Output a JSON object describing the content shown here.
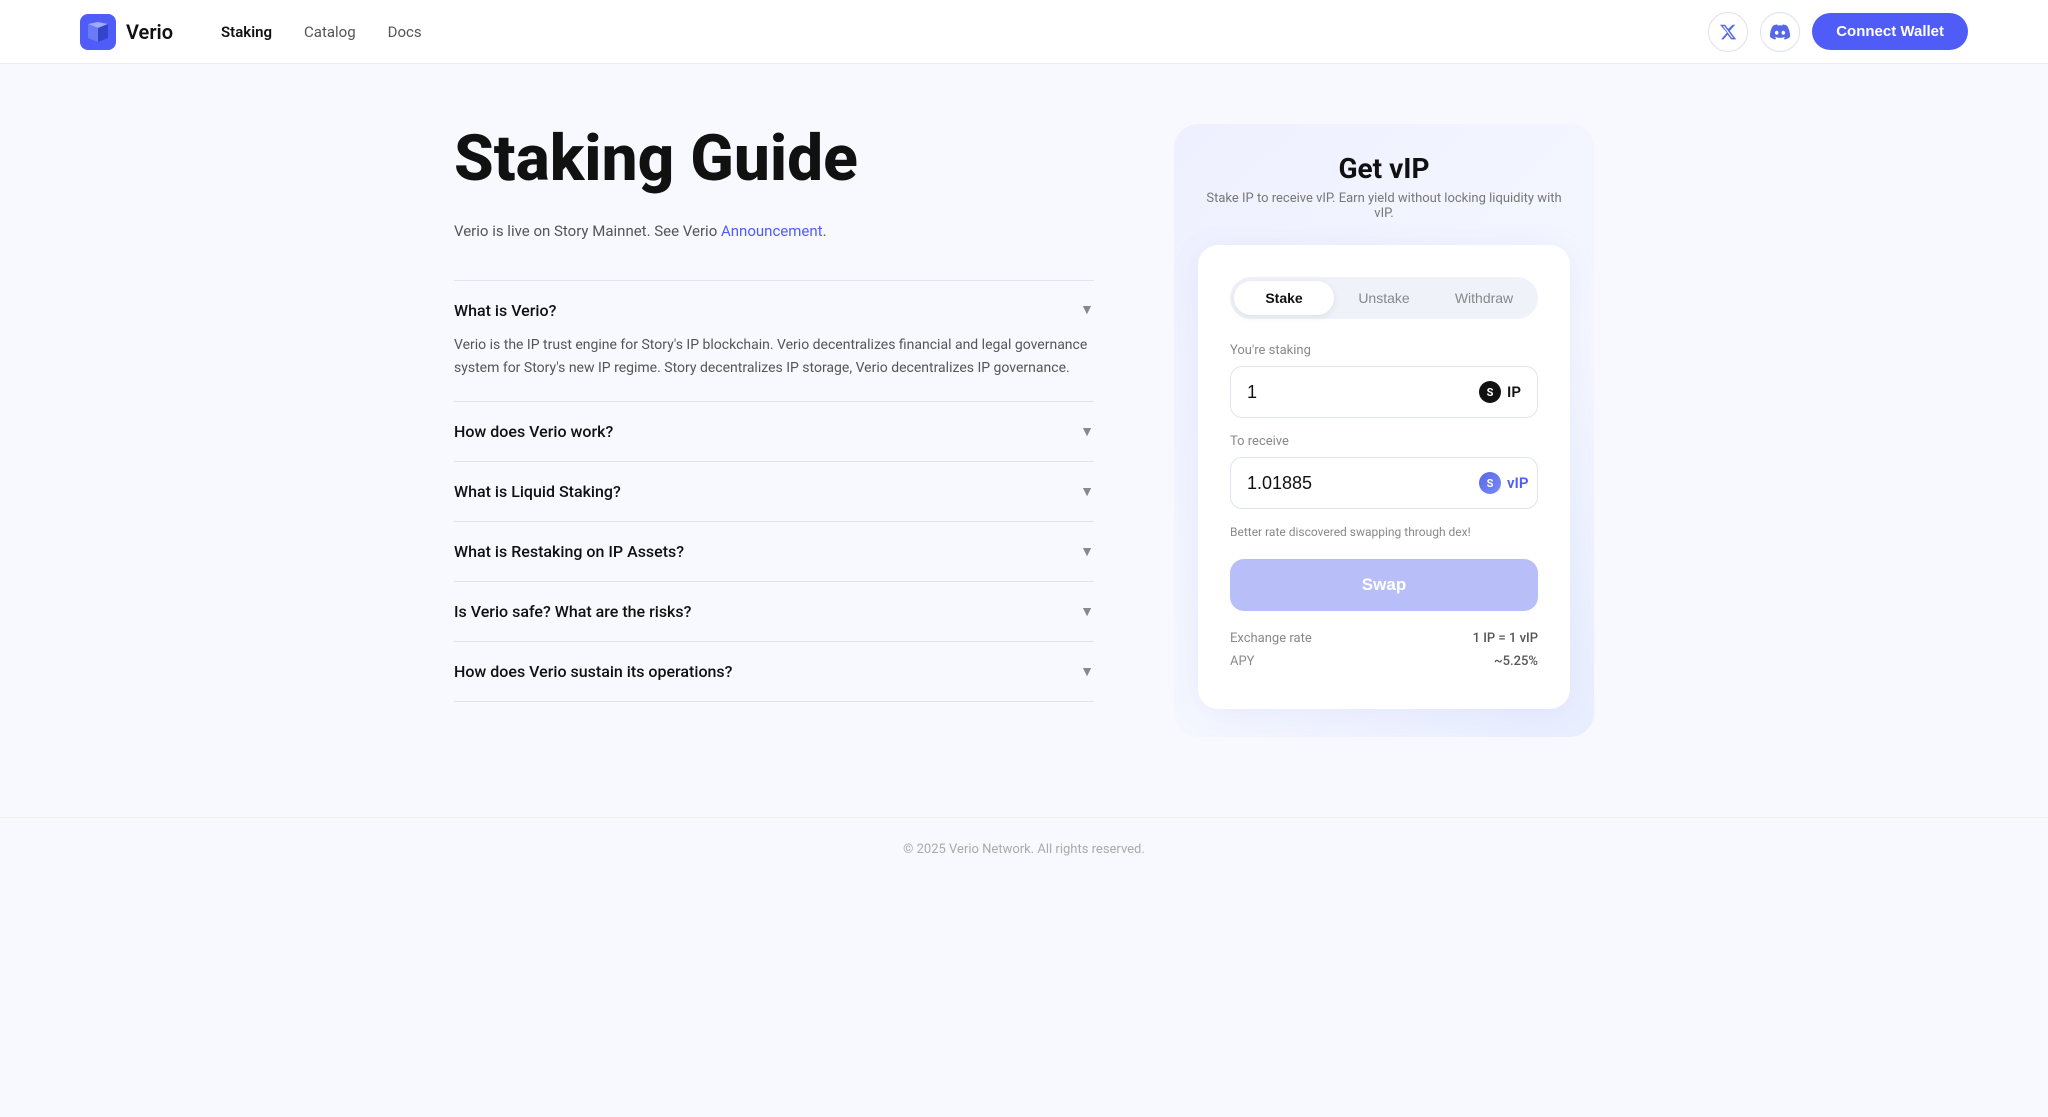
{
  "brand": {
    "name": "Verio",
    "logo_alt": "Verio logo"
  },
  "navbar": {
    "links": [
      {
        "label": "Staking",
        "active": true
      },
      {
        "label": "Catalog",
        "active": false
      },
      {
        "label": "Docs",
        "active": false
      }
    ],
    "twitter_label": "X",
    "discord_label": "Discord",
    "connect_wallet": "Connect Wallet"
  },
  "left": {
    "title": "Staking Guide",
    "subtitle_prefix": "Verio is live on Story Mainnet. See Verio ",
    "subtitle_link": "Announcement",
    "subtitle_suffix": ".",
    "faq": [
      {
        "id": "what-is-verio",
        "question": "What is Verio?",
        "open": true,
        "answer": "Verio is the IP trust engine for Story's IP blockchain. Verio decentralizes financial and legal governance system for Story's new IP regime. Story decentralizes IP storage, Verio decentralizes IP governance."
      },
      {
        "id": "how-does-verio-work",
        "question": "How does Verio work?",
        "open": false,
        "answer": ""
      },
      {
        "id": "what-is-liquid-staking",
        "question": "What is Liquid Staking?",
        "open": false,
        "answer": ""
      },
      {
        "id": "what-is-restaking",
        "question": "What is Restaking on IP Assets?",
        "open": false,
        "answer": ""
      },
      {
        "id": "is-verio-safe",
        "question": "Is Verio safe? What are the risks?",
        "open": false,
        "answer": ""
      },
      {
        "id": "how-sustain",
        "question": "How does Verio sustain its operations?",
        "open": false,
        "answer": ""
      }
    ]
  },
  "right": {
    "title": "Get vIP",
    "subtitle": "Stake IP to receive vIP. Earn yield without locking liquidity with vIP.",
    "tabs": [
      {
        "label": "Stake",
        "active": true
      },
      {
        "label": "Unstake",
        "active": false
      },
      {
        "label": "Withdraw",
        "active": false
      }
    ],
    "staking_label": "You're staking",
    "staking_value": "1",
    "staking_currency": "IP",
    "receive_label": "To receive",
    "receive_value": "1.01885",
    "receive_currency": "vIP",
    "better_rate_note": "Better rate discovered swapping through dex!",
    "swap_btn": "Swap",
    "exchange_rate_label": "Exchange rate",
    "exchange_rate_value": "1 IP = 1 vIP",
    "apy_label": "APY",
    "apy_value": "~5.25%"
  },
  "footer": {
    "text": "© 2025 Verio Network. All rights reserved."
  }
}
